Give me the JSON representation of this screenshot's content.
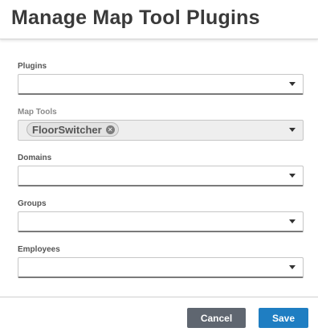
{
  "dialog": {
    "title": "Manage Map Tool Plugins"
  },
  "fields": {
    "plugins": {
      "label": "Plugins",
      "value": ""
    },
    "map_tools": {
      "label": "Map Tools",
      "selected": [
        "FloorSwitcher"
      ],
      "disabled": true
    },
    "domains": {
      "label": "Domains",
      "value": ""
    },
    "groups": {
      "label": "Groups",
      "value": ""
    },
    "employees": {
      "label": "Employees",
      "value": ""
    }
  },
  "footer": {
    "cancel_label": "Cancel",
    "save_label": "Save"
  },
  "colors": {
    "primary": "#1f7ec2",
    "secondary": "#5f6670"
  },
  "icons": {
    "dropdown": "chevron-down-icon",
    "chip_remove": "close-circle-icon"
  }
}
